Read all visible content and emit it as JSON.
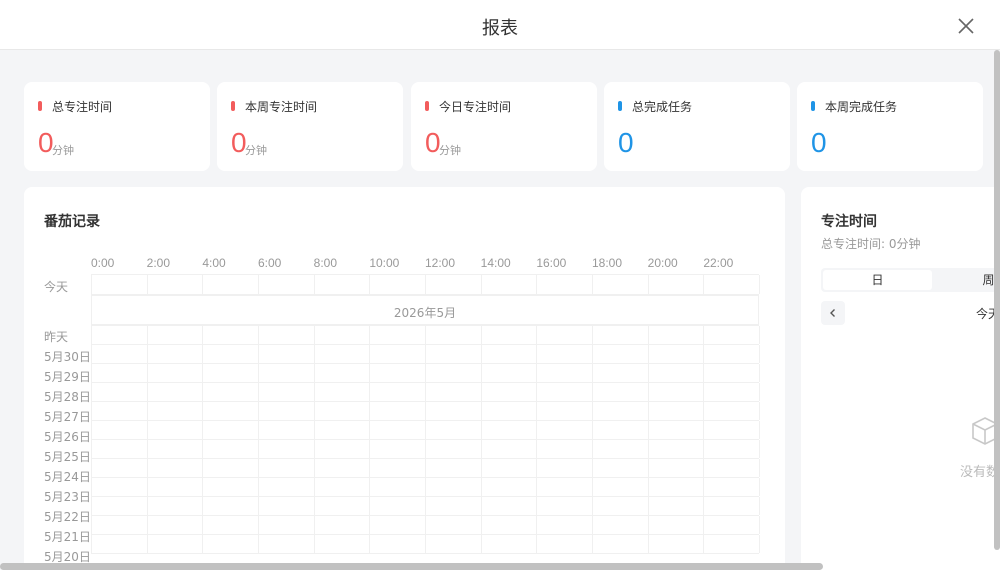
{
  "header": {
    "title": "报表"
  },
  "stats": [
    {
      "label": "总专注时间",
      "value": "0",
      "unit": "分钟",
      "color": "#f25c5c"
    },
    {
      "label": "本周专注时间",
      "value": "0",
      "unit": "分钟",
      "color": "#f25c5c"
    },
    {
      "label": "今日专注时间",
      "value": "0",
      "unit": "分钟",
      "color": "#f25c5c"
    },
    {
      "label": "总完成任务",
      "value": "0",
      "unit": "",
      "color": "#1f94e6"
    },
    {
      "label": "本周完成任务",
      "value": "0",
      "unit": "",
      "color": "#1f94e6"
    }
  ],
  "record": {
    "title": "番茄记录",
    "hours": [
      "0:00",
      "2:00",
      "4:00",
      "6:00",
      "8:00",
      "10:00",
      "12:00",
      "14:00",
      "16:00",
      "18:00",
      "20:00",
      "22:00"
    ],
    "month_label": "2026年5月",
    "today_label": "今天",
    "days": [
      "昨天",
      "5月30日",
      "5月29日",
      "5月28日",
      "5月27日",
      "5月26日",
      "5月25日",
      "5月24日",
      "5月23日",
      "5月22日",
      "5月21日",
      "5月20日"
    ]
  },
  "focus": {
    "title": "专注时间",
    "subtitle": "总专注时间: 0分钟",
    "tabs": [
      "日",
      "周"
    ],
    "active_tab": "日",
    "nav_label": "今天",
    "empty_text": "没有数据"
  },
  "colors": {
    "focus": "#f25c5c",
    "task": "#1f94e6",
    "background": "#f4f5f7"
  },
  "icons": {
    "close": "close-icon",
    "prev": "chevron-left-icon",
    "empty": "empty-box-icon"
  }
}
